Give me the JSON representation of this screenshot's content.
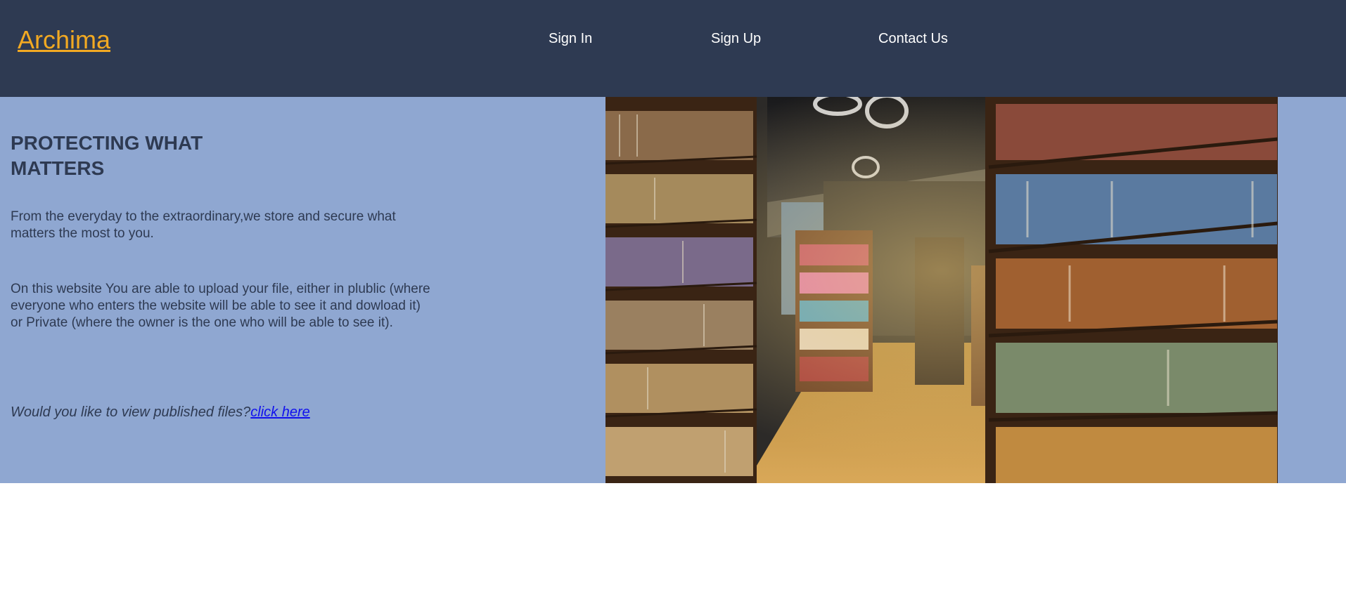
{
  "brand": {
    "name": "Archima"
  },
  "nav": {
    "sign_in": "Sign In",
    "sign_up": "Sign Up",
    "contact": "Contact Us"
  },
  "hero": {
    "title": "PROTECTING WHAT MATTERS",
    "paragraph_1": "From the everyday to the extraordinary,we store and secure what matters the most to you.",
    "paragraph_2": "On this website You are able to upload your file, either in plublic (where everyone who enters the website will be able to see it and dowload it) or Private (where the owner is the one who will be able to see it).",
    "cta_prompt": "Would you like to view published files?",
    "cta_link": "click here",
    "image_icon": "library-bookshelves-photo"
  },
  "colors": {
    "navbar_bg": "#2e3a52",
    "brand": "#f2a922",
    "hero_bg": "#8fa7d1",
    "text_dark": "#2e3a52",
    "link": "#1010ee"
  }
}
